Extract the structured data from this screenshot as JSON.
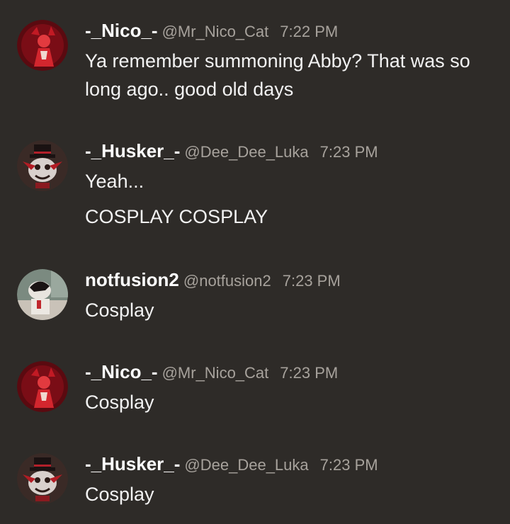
{
  "messages": [
    {
      "username": "-_Nico_-",
      "handle": "@Mr_Nico_Cat",
      "time": "7:22 PM",
      "avatar": "nico-avatar-icon",
      "lines": [
        "Ya remember summoning Abby? That was so long ago.. good old days"
      ]
    },
    {
      "username": "-_Husker_-",
      "handle": "@Dee_Dee_Luka",
      "time": "7:23 PM",
      "avatar": "husker-avatar-icon",
      "lines": [
        "Yeah...",
        "COSPLAY COSPLAY"
      ]
    },
    {
      "username": "notfusion2",
      "handle": "@notfusion2",
      "time": "7:23 PM",
      "avatar": "notfusion-avatar-icon",
      "lines": [
        "Cosplay"
      ]
    },
    {
      "username": "-_Nico_-",
      "handle": "@Mr_Nico_Cat",
      "time": "7:23 PM",
      "avatar": "nico-avatar-icon",
      "lines": [
        "Cosplay"
      ]
    },
    {
      "username": "-_Husker_-",
      "handle": "@Dee_Dee_Luka",
      "time": "7:23 PM",
      "avatar": "husker-avatar-icon",
      "lines": [
        "Cosplay"
      ]
    }
  ],
  "colors": {
    "background": "#2e2b28",
    "username": "#ffffff",
    "meta": "#a7a29c",
    "text": "#f2f2f2"
  }
}
